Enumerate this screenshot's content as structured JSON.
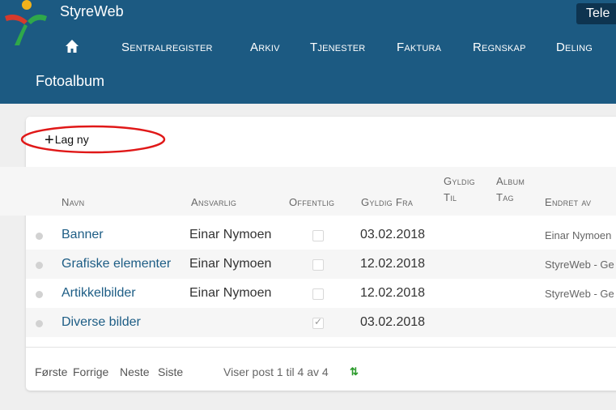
{
  "header": {
    "app_name": "StyreWeb",
    "right_label": "Tele",
    "nav": [
      "Sentralregister",
      "Arkiv",
      "Tjenester",
      "Faktura",
      "Regnskap",
      "Deling"
    ],
    "page_title": "Fotoalbum"
  },
  "toolbar": {
    "new_label": "Lag ny"
  },
  "table": {
    "headers": {
      "navn": "Navn",
      "ansvarlig": "Ansvarlig",
      "offentlig": "Offentlig",
      "gyldig_fra": "Gyldig Fra",
      "gyldig_til_1": "Gyldig",
      "gyldig_til_2": "Til",
      "album_tag_1": "Album",
      "album_tag_2": "Tag",
      "endret_av": "Endret av"
    },
    "rows": [
      {
        "navn": "Banner",
        "ansvarlig": "Einar Nymoen",
        "offentlig": false,
        "gyldig_fra": "03.02.2018",
        "endret_av": "Einar Nymoen"
      },
      {
        "navn": "Grafiske elementer",
        "ansvarlig": "Einar Nymoen",
        "offentlig": false,
        "gyldig_fra": "12.02.2018",
        "endret_av": "StyreWeb - Ge"
      },
      {
        "navn": "Artikkelbilder",
        "ansvarlig": "Einar Nymoen",
        "offentlig": false,
        "gyldig_fra": "12.02.2018",
        "endret_av": "StyreWeb - Ge"
      },
      {
        "navn": "Diverse bilder",
        "ansvarlig": "",
        "offentlig": true,
        "gyldig_fra": "03.02.2018",
        "endret_av": ""
      }
    ]
  },
  "pager": {
    "first": "Første",
    "prev": "Forrige",
    "next": "Neste",
    "last": "Siste"
  },
  "status_text": "Viser post 1 til 4 av 4",
  "colors": {
    "header": "#1c5a82",
    "link": "#1d5d85",
    "annotation": "#e01818"
  }
}
